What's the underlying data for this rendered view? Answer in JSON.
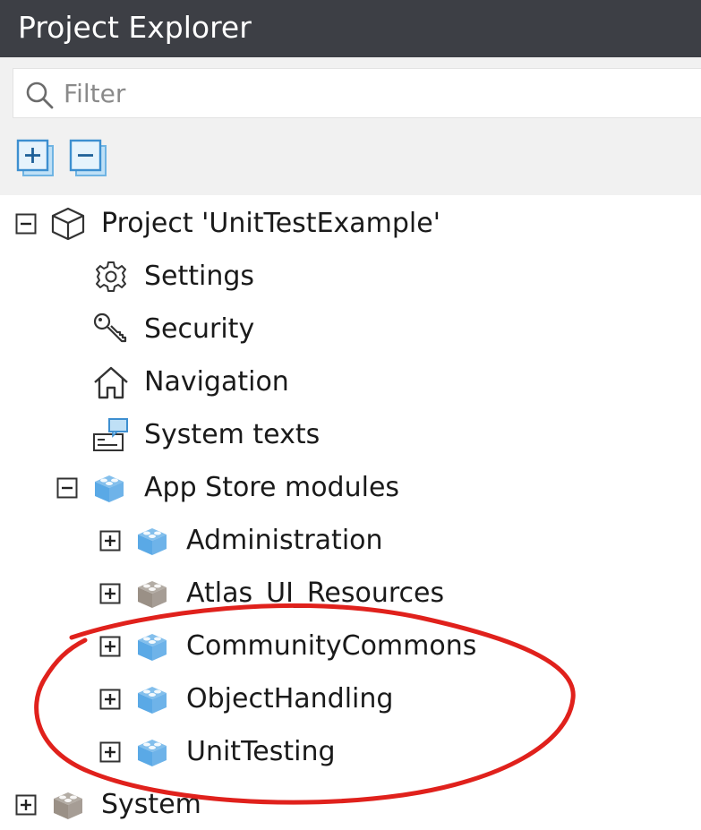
{
  "panel": {
    "title": "Project Explorer"
  },
  "filter": {
    "placeholder": "Filter",
    "value": ""
  },
  "toolbar": {
    "expand_all_icon": "expand-all-icon",
    "collapse_all_icon": "collapse-all-icon"
  },
  "tree": {
    "project": {
      "label": "Project 'UnitTestExample'",
      "state": "expanded",
      "icon": "cube-outline-icon"
    },
    "settings": {
      "label": "Settings",
      "icon": "gear-icon"
    },
    "security": {
      "label": "Security",
      "icon": "key-icon"
    },
    "navigation": {
      "label": "Navigation",
      "icon": "home-icon"
    },
    "system_texts": {
      "label": "System texts",
      "icon": "system-texts-icon"
    },
    "app_store_modules": {
      "label": "App Store modules",
      "state": "expanded",
      "icon": "module-blue-icon"
    },
    "administration": {
      "label": "Administration",
      "state": "collapsed",
      "icon": "module-blue-icon"
    },
    "atlas_ui": {
      "label": "Atlas_UI_Resources",
      "state": "collapsed",
      "icon": "module-gray-icon"
    },
    "community_commons": {
      "label": "CommunityCommons",
      "state": "collapsed",
      "icon": "module-blue-icon"
    },
    "object_handling": {
      "label": "ObjectHandling",
      "state": "collapsed",
      "icon": "module-blue-icon"
    },
    "unit_testing": {
      "label": "UnitTesting",
      "state": "collapsed",
      "icon": "module-blue-icon"
    },
    "system": {
      "label": "System",
      "state": "collapsed",
      "icon": "module-gray-icon"
    }
  },
  "colors": {
    "titlebar_bg": "#3d3f45",
    "toolbar_bg": "#f1f1f1",
    "module_blue": "#5aa9e6",
    "module_gray": "#9a9086",
    "annotation_red": "#e0211c"
  }
}
